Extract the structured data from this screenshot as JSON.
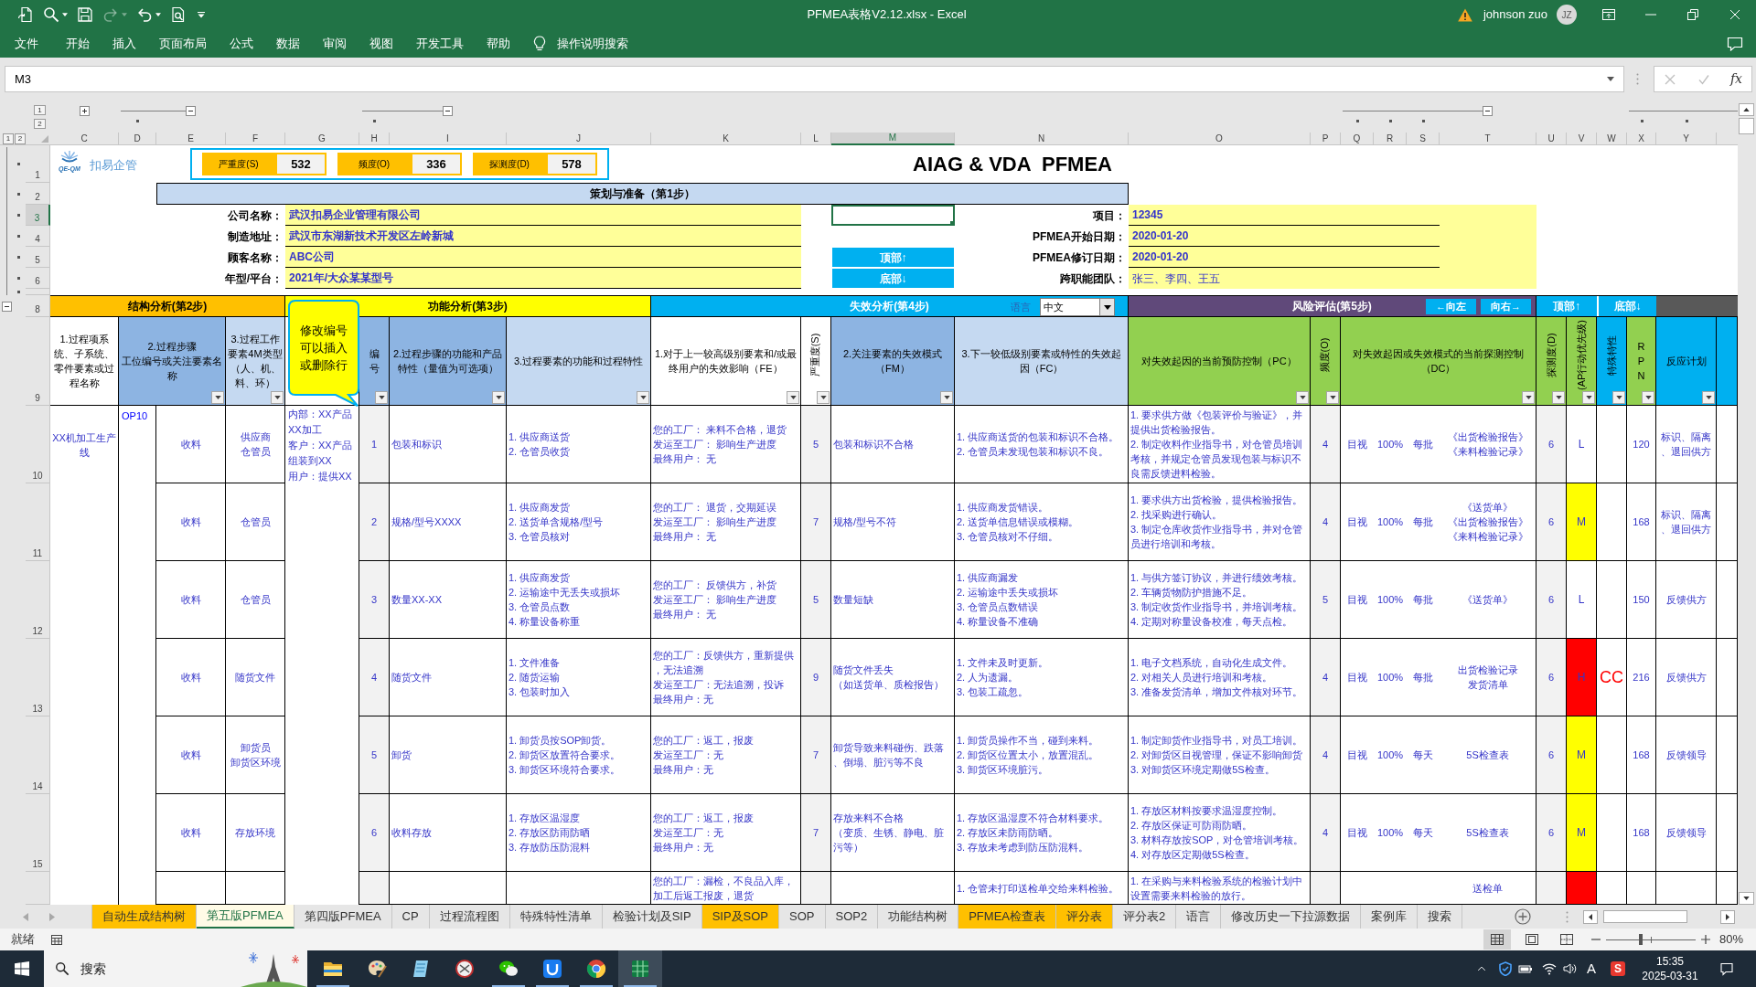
{
  "title_bar": {
    "quick_access": [
      {
        "kind": "autosave",
        "disabled": false
      },
      {
        "kind": "search",
        "disabled": false
      },
      {
        "kind": "save",
        "disabled": false
      },
      {
        "kind": "redo",
        "disabled": true
      },
      {
        "kind": "undo",
        "disabled": false
      },
      {
        "kind": "print_preview",
        "disabled": false
      }
    ],
    "title": "PFMEA表格V2.12.xlsx - Excel",
    "user": "johnson zuo",
    "avatar": "JZ"
  },
  "menu": {
    "items": [
      "文件",
      "开始",
      "插入",
      "页面布局",
      "公式",
      "数据",
      "审阅",
      "视图",
      "开发工具",
      "帮助"
    ],
    "tell_me": "操作说明搜索"
  },
  "formula_bar": {
    "name_box": "M3",
    "buttons": [
      {
        "kind": "cancel",
        "disabled": true
      },
      {
        "kind": "enter",
        "disabled": true
      }
    ],
    "function_button": "fx"
  },
  "outline_levels": {
    "columns": [
      "1",
      "2"
    ],
    "rows": [
      "1",
      "2"
    ]
  },
  "column_headers": [
    {
      "label": "C",
      "selected": false
    },
    {
      "label": "D",
      "selected": false
    },
    {
      "label": "E",
      "selected": false
    },
    {
      "label": "F",
      "selected": false
    },
    {
      "label": "G",
      "selected": false
    },
    {
      "label": "H",
      "selected": false
    },
    {
      "label": "I",
      "selected": false
    },
    {
      "label": "J",
      "selected": false
    },
    {
      "label": "K",
      "selected": false
    },
    {
      "label": "L",
      "selected": false
    },
    {
      "label": "M",
      "selected": true
    },
    {
      "label": "N",
      "selected": false
    },
    {
      "label": "O",
      "selected": false
    },
    {
      "label": "P",
      "selected": false
    },
    {
      "label": "Q",
      "selected": false
    },
    {
      "label": "R",
      "selected": false
    },
    {
      "label": "S",
      "selected": false
    },
    {
      "label": "T",
      "selected": false
    },
    {
      "label": "U",
      "selected": false
    },
    {
      "label": "V",
      "selected": false
    },
    {
      "label": "W",
      "selected": false
    },
    {
      "label": "X",
      "selected": false
    },
    {
      "label": "Y",
      "selected": false
    }
  ],
  "row_headers": [
    {
      "label": "1",
      "selected": false
    },
    {
      "label": "2",
      "selected": false
    },
    {
      "label": "3",
      "selected": true
    },
    {
      "label": "4",
      "selected": false
    },
    {
      "label": "5",
      "selected": false
    },
    {
      "label": "6",
      "selected": false
    },
    {
      "label": "8",
      "selected": false
    },
    {
      "label": "9",
      "selected": false
    },
    {
      "label": "10",
      "selected": false
    },
    {
      "label": "11",
      "selected": false
    },
    {
      "label": "12",
      "selected": false
    },
    {
      "label": "13",
      "selected": false
    },
    {
      "label": "14",
      "selected": false
    },
    {
      "label": "15",
      "selected": false
    }
  ],
  "sheet": {
    "logo": {
      "text": "扣易企管",
      "tagline": "QE-QM"
    },
    "scores": [
      {
        "label": "严重度(S)",
        "value": "532"
      },
      {
        "label": "频度(O)",
        "value": "336"
      },
      {
        "label": "探测度(D)",
        "value": "578"
      }
    ],
    "title": "AIAG & VDA  PFMEA",
    "planning_title": "策划与准备（第1步）",
    "info_left": [
      {
        "label": "公司名称：",
        "value": "武汉扣易企业管理有限公司"
      },
      {
        "label": "制造地址：",
        "value": "武汉市东湖新技术开发区左岭新城"
      },
      {
        "label": "顾客名称：",
        "value": "ABC公司"
      },
      {
        "label": "年型/平台：",
        "value": "2021年/大众某某型号"
      }
    ],
    "nav_buttons": [
      "顶部↑",
      "底部↓"
    ],
    "info_right": [
      {
        "label": "项目：",
        "value": "12345"
      },
      {
        "label": "PFMEA开始日期：",
        "value": "2020-01-20"
      },
      {
        "label": "PFMEA修订日期：",
        "value": "2020-01-20"
      },
      {
        "label": "跨职能团队：",
        "value": "张三、李四、王五"
      }
    ],
    "sections": [
      {
        "title": "结构分析(第2步)",
        "color": "#ffc000"
      },
      {
        "title": "功能分析(第3步)",
        "color": "#ffff00"
      },
      {
        "title": "失效分析(第4步)",
        "color": "#00b0f0"
      },
      {
        "title": "风险评估(第5步)",
        "color": "#60497a"
      }
    ],
    "language": {
      "label": "语言",
      "value": "中文"
    },
    "scroll_buttons": [
      "←向左",
      "向右→"
    ],
    "jump_buttons": [
      "顶部↑",
      "底部↓"
    ],
    "callout": "修改编号可以插入或删除行",
    "headers": [
      {
        "text": "1.过程项系统、子系统、零件要素或过程名称",
        "color": "#ffffff",
        "kind": "text",
        "filter": false
      },
      {
        "text": [
          "2.过程步骤",
          "工位编号或关注要素名称"
        ],
        "color": "#8db4e2",
        "kind": "text",
        "filter": true
      },
      {
        "text": "3.过程工作要素4M类型（人、机、料、环）",
        "color": "#c5d9f1",
        "kind": "text",
        "filter": true
      },
      {
        "text": "编号",
        "color": "#8db4e2",
        "kind": "stacked",
        "filter": true
      },
      {
        "text": "2.过程步骤的功能和产品特性（量值为可选项）",
        "color": "#8db4e2",
        "kind": "text",
        "filter": true
      },
      {
        "text": "3.过程要素的功能和过程特性",
        "color": "#c5d9f1",
        "kind": "text",
        "filter": true
      },
      {
        "text": "1.对于上一较高级别要素和/或最终用户的失效影响（FE）",
        "color": "#ffffff",
        "kind": "text",
        "filter": true
      },
      {
        "text": "严重度(S)",
        "color": "#ffffff",
        "kind": "rotated",
        "filter": true
      },
      {
        "text": "2.关注要素的失效模式（FM）",
        "color": "#8db4e2",
        "kind": "text",
        "filter": true
      },
      {
        "text": "3.下一较低级别要素或特性的失效起因（FC）",
        "color": "#c5d9f1",
        "kind": "text",
        "filter": false
      },
      {
        "text": "对失效起因的当前预防控制（PC）",
        "color": "#92d050",
        "kind": "text",
        "filter": true
      },
      {
        "text": "频度(O)",
        "color": "#92d050",
        "kind": "rotated",
        "filter": true
      },
      {
        "text": "对失效起因或失效模式的当前探测控制（DC）",
        "color": "#92d050",
        "kind": "text",
        "filter": true
      },
      {
        "text": "探测度(D)",
        "color": "#92d050",
        "kind": "rotated",
        "filter": true
      },
      {
        "text": "(AP行动优先级)",
        "color": "#92d050",
        "kind": "rotated",
        "filter": true
      },
      {
        "text": "特殊特性",
        "color": "#00b0f0",
        "kind": "rotated",
        "filter": true
      },
      {
        "text": "RPN",
        "color": "#92d050",
        "kind": "stacked",
        "filter": true
      },
      {
        "text": "反应计划",
        "color": "#00b0f0",
        "kind": "text",
        "filter": true
      }
    ],
    "process_item": "XX机加工生产线",
    "process_step": "OP10",
    "next_level_functions": [
      "内部：XX产品XX加工",
      "客户：XX产品组装到XX",
      "用户：提供XX"
    ],
    "rows": [
      {
        "process_type": "收料",
        "work_element": [
          "供应商",
          "仓管员"
        ],
        "no": "1",
        "function": "包装和标识",
        "element_functions": [
          "1. 供应商送货",
          "2. 仓管员收货"
        ],
        "effects": [
          "您的工厂： 来料不合格，退货",
          "发运至工厂： 影响生产进度",
          "最终用户： 无"
        ],
        "severity": "5",
        "failure_mode": "包装和标识不合格",
        "causes": [
          "1. 供应商送货的包装和标识不合格。",
          "2. 仓管员未发现包装和标识不良。"
        ],
        "prevention": [
          "1. 要求供方做《包装评价与验证》，并提供出货检验报告。",
          "2. 制定收料作业指导书，对仓管员培训考核，并规定仓管员发现包装与标识不良需反馈进料检验。"
        ],
        "occurrence": "4",
        "method": "目视",
        "sample": "100%",
        "frequency": "每批",
        "detection_controls": [
          "《出货检验报告》",
          "《来料检验记录》"
        ],
        "detection": "6",
        "ap": {
          "text": "L",
          "color": "#ffffff"
        },
        "rpn": "120",
        "reaction_plan": "标识、隔离、退回供方"
      },
      {
        "process_type": "收料",
        "work_element": "仓管员",
        "no": "2",
        "function": "规格/型号XXXX",
        "element_functions": [
          "1. 供应商发货",
          "2. 送货单含规格/型号",
          "3. 仓管员核对"
        ],
        "effects": [
          "您的工厂： 退货，交期延误",
          "发运至工厂： 影响生产进度",
          "最终用户： 无"
        ],
        "severity": "7",
        "failure_mode": "规格/型号不符",
        "causes": [
          "1. 供应商发货错误。",
          "2. 送货单信息错误或模糊。",
          "3. 仓管员核对不仔细。"
        ],
        "prevention": [
          "1. 要求供方出货检验，提供检验报告。",
          "2. 找采购进行确认。",
          "3. 制定仓库收货作业指导书，并对仓管员进行培训和考核。"
        ],
        "occurrence": "4",
        "method": "目视",
        "sample": "100%",
        "frequency": "每批",
        "detection_controls": [
          "《送货单》",
          "《出货检验报告》",
          "《来料检验记录》"
        ],
        "detection": "6",
        "ap": {
          "text": "M",
          "color": "#ffff00"
        },
        "rpn": "168",
        "reaction_plan": "标识、隔离、退回供方"
      },
      {
        "process_type": "收料",
        "work_element": "仓管员",
        "no": "3",
        "function": "数量XX-XX",
        "element_functions": [
          "1. 供应商发货",
          "2. 运输途中无丢失或损坏",
          "3. 仓管员点数",
          "4. 称量设备称重"
        ],
        "effects": [
          "您的工厂： 反馈供方，补货",
          "发运至工厂： 影响生产进度",
          "最终用户： 无"
        ],
        "severity": "5",
        "failure_mode": "数量短缺",
        "causes": [
          "1. 供应商漏发",
          "2. 运输途中丢失或损坏",
          "3. 仓管员点数错误",
          "4. 称量设备不准确"
        ],
        "prevention": [
          "1. 与供方签订协议，并进行绩效考核。",
          "2. 车辆货物防护措施不足。",
          "3. 制定收货作业指导书，并培训考核。",
          "4. 定期对称量设备校准，每天点检。"
        ],
        "occurrence": "5",
        "method": "目视",
        "sample": "100%",
        "frequency": "每批",
        "detection_controls": [
          "《送货单》"
        ],
        "detection": "6",
        "ap": {
          "text": "L",
          "color": "#ffffff"
        },
        "rpn": "150",
        "reaction_plan": "反馈供方"
      },
      {
        "process_type": "收料",
        "work_element": "随货文件",
        "no": "4",
        "function": "随货文件",
        "element_functions": [
          "1. 文件准备",
          "2. 随货运输",
          "3. 包装时加入"
        ],
        "effects": [
          "您的工厂：反馈供方，重新提供，无法追溯",
          "发运至工厂：无法追溯，投诉",
          "最终用户：无"
        ],
        "severity": "9",
        "failure_mode": [
          "随货文件丢失",
          "（如送货单、质检报告）"
        ],
        "causes": [
          "1. 文件未及时更新。",
          "2. 人为遗漏。",
          "3. 包装工疏忽。"
        ],
        "prevention": [
          "1. 电子文档系统，自动化生成文件。",
          "2. 对相关人员进行培训和考核。",
          "3. 准备发货清单，增加文件核对环节。"
        ],
        "occurrence": "4",
        "method": "目视",
        "sample": "100%",
        "frequency": "每批",
        "detection_controls": [
          "出货检验记录",
          "发货清单"
        ],
        "detection": "6",
        "ap": {
          "text": "H",
          "color": "#ff0000"
        },
        "special_characteristic": "CC",
        "rpn": "216",
        "reaction_plan": "反馈供方"
      },
      {
        "process_type": "收料",
        "work_element": [
          "卸货员",
          "卸货区环境"
        ],
        "no": "5",
        "function": "卸货",
        "element_functions": [
          "1. 卸货员按SOP卸货。",
          "2. 卸货区放置符合要求。",
          "3. 卸货区环境符合要求。"
        ],
        "effects": [
          "您的工厂：返工，报废",
          "发运至工厂：无",
          "最终用户：无"
        ],
        "severity": "7",
        "failure_mode": "卸货导致来料碰伤、跌落、倒塌、脏污等不良",
        "causes": [
          "1. 卸货员操作不当，碰到来料。",
          "2. 卸货区位置太小，放置混乱。",
          "3. 卸货区环境脏污。"
        ],
        "prevention": [
          "1. 制定卸货作业指导书，对员工培训。",
          "2. 对卸货区目视管理，保证不影响卸货",
          "3. 对卸货区环境定期做5S检查。"
        ],
        "occurrence": "4",
        "method": "目视",
        "sample": "100%",
        "frequency": "每天",
        "detection_controls": [
          "5S检查表"
        ],
        "detection": "6",
        "ap": {
          "text": "M",
          "color": "#ffff00"
        },
        "rpn": "168",
        "reaction_plan": "反馈领导"
      },
      {
        "process_type": "收料",
        "work_element": "存放环境",
        "no": "6",
        "function": "收料存放",
        "element_functions": [
          "1. 存放区温湿度",
          "2. 存放区防雨防晒",
          "3. 存放防压防混料"
        ],
        "effects": [
          "您的工厂：返工，报废",
          "发运至工厂：无",
          "最终用户：无"
        ],
        "severity": "7",
        "failure_mode": [
          "存放来料不合格",
          "（变质、生锈、静电、脏污等）"
        ],
        "causes": [
          "1. 存放区温湿度不符合材料要求。",
          "2. 存放区未防雨防晒。",
          "3. 存放未考虑到防压防混料。"
        ],
        "prevention": [
          "1. 存放区材料按要求温湿度控制。",
          "2. 存放区保证可防雨防晒。",
          "3. 材料存放按SOP，对仓管培训考核。",
          "4. 对存放区定期做5S检查。"
        ],
        "occurrence": "4",
        "method": "目视",
        "sample": "100%",
        "frequency": "每天",
        "detection_controls": [
          "5S检查表"
        ],
        "detection": "6",
        "ap": {
          "text": "M",
          "color": "#ffff00"
        },
        "rpn": "168",
        "reaction_plan": "反馈领导"
      },
      {
        "effects": [
          "您的工厂：漏检，不良品入库，加工后返工报废，退货"
        ],
        "causes": [
          "1. 仓管未打印送检单交给来料检验。"
        ],
        "prevention": [
          "1. 在采购与来料检验系统的检验计划中设置需要来料检验的放行。"
        ],
        "detection_controls": [
          "送检单"
        ],
        "ap": {
          "color": "#ff0000"
        }
      }
    ]
  },
  "sheet_tabs": [
    {
      "label": "自动生成结构树",
      "selected": false,
      "color": "#ffc000"
    },
    {
      "label": "第五版PFMEA",
      "selected": true
    },
    {
      "label": "第四版PFMEA",
      "selected": false
    },
    {
      "label": "CP",
      "selected": false
    },
    {
      "label": "过程流程图",
      "selected": false
    },
    {
      "label": "特殊特性清单",
      "selected": false
    },
    {
      "label": "检验计划及SIP",
      "selected": false
    },
    {
      "label": "SIP及SOP",
      "selected": false,
      "color": "#ffc000"
    },
    {
      "label": "SOP",
      "selected": false
    },
    {
      "label": "SOP2",
      "selected": false
    },
    {
      "label": "功能结构树",
      "selected": false
    },
    {
      "label": "PFMEA检查表",
      "selected": false,
      "color": "#ffc000"
    },
    {
      "label": "评分表",
      "selected": false,
      "color": "#ffc000"
    },
    {
      "label": "评分表2",
      "selected": false
    },
    {
      "label": "语言",
      "selected": false
    },
    {
      "label": "修改历史一下拉源数据",
      "selected": false
    },
    {
      "label": "案例库",
      "selected": false
    },
    {
      "label": "搜索",
      "selected": false
    }
  ],
  "status_bar": {
    "mode": "就绪",
    "views": [
      {
        "kind": "normal",
        "selected": true
      },
      {
        "kind": "page_layout",
        "selected": false
      },
      {
        "kind": "page_break",
        "selected": false
      }
    ],
    "zoom_slider": {
      "level": 0.39
    },
    "zoom": "80%"
  },
  "taskbar": {
    "search": {
      "placeholder": "搜索"
    },
    "apps": [
      {
        "kind": "folder",
        "running": true,
        "selected": false
      },
      {
        "kind": "paint",
        "running": false,
        "selected": false
      },
      {
        "kind": "notepad",
        "running": false,
        "selected": false
      },
      {
        "kind": "snip",
        "running": false,
        "selected": false
      },
      {
        "kind": "chat",
        "running": true,
        "selected": false
      },
      {
        "kind": "tile",
        "running": true,
        "selected": false
      },
      {
        "kind": "browser",
        "running": true,
        "selected": false
      },
      {
        "kind": "spreadsheet",
        "running": true,
        "selected": true
      }
    ],
    "ime": "A",
    "ime_logo": "S",
    "time": "15:35",
    "date": "2025-03-31"
  }
}
